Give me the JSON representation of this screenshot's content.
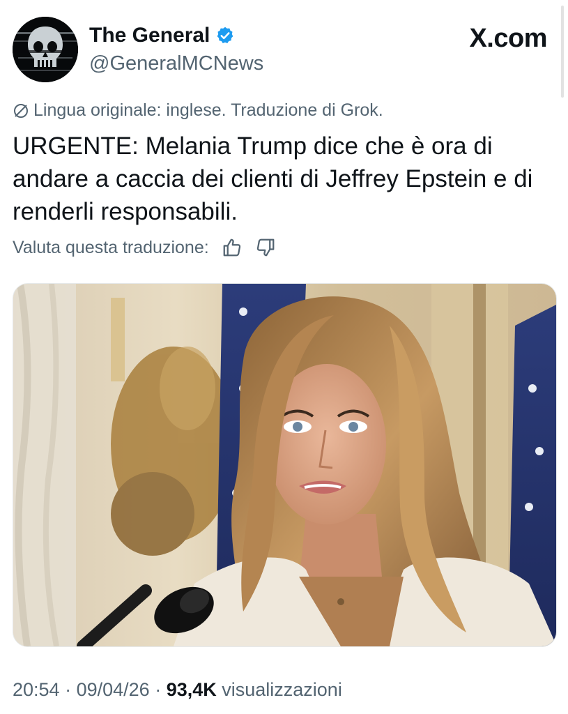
{
  "author": {
    "display_name": "The General",
    "handle": "@GeneralMCNews",
    "verified_color": "#1d9bf0"
  },
  "site_label": "X.com",
  "translation_note": "Lingua originale: inglese. Traduzione di Grok.",
  "tweet_text": "URGENTE: Melania Trump dice che è ora di andare a caccia dei clienti di Jeffrey Epstein e di renderli responsabili.",
  "rate_translation_label": "Valuta questa traduzione:",
  "meta": {
    "time": "20:54",
    "sep1": " · ",
    "date": "09/04/26",
    "sep2": " · ",
    "views_count": "93,4K",
    "views_label": " visualizzazioni"
  },
  "colors": {
    "text_primary": "#0f1419",
    "text_secondary": "#536471",
    "verified_blue": "#1d9bf0"
  },
  "icons": [
    "skull-avatar",
    "verified-badge-icon",
    "globe-slash-icon",
    "thumbs-up-icon",
    "thumbs-down-icon"
  ]
}
